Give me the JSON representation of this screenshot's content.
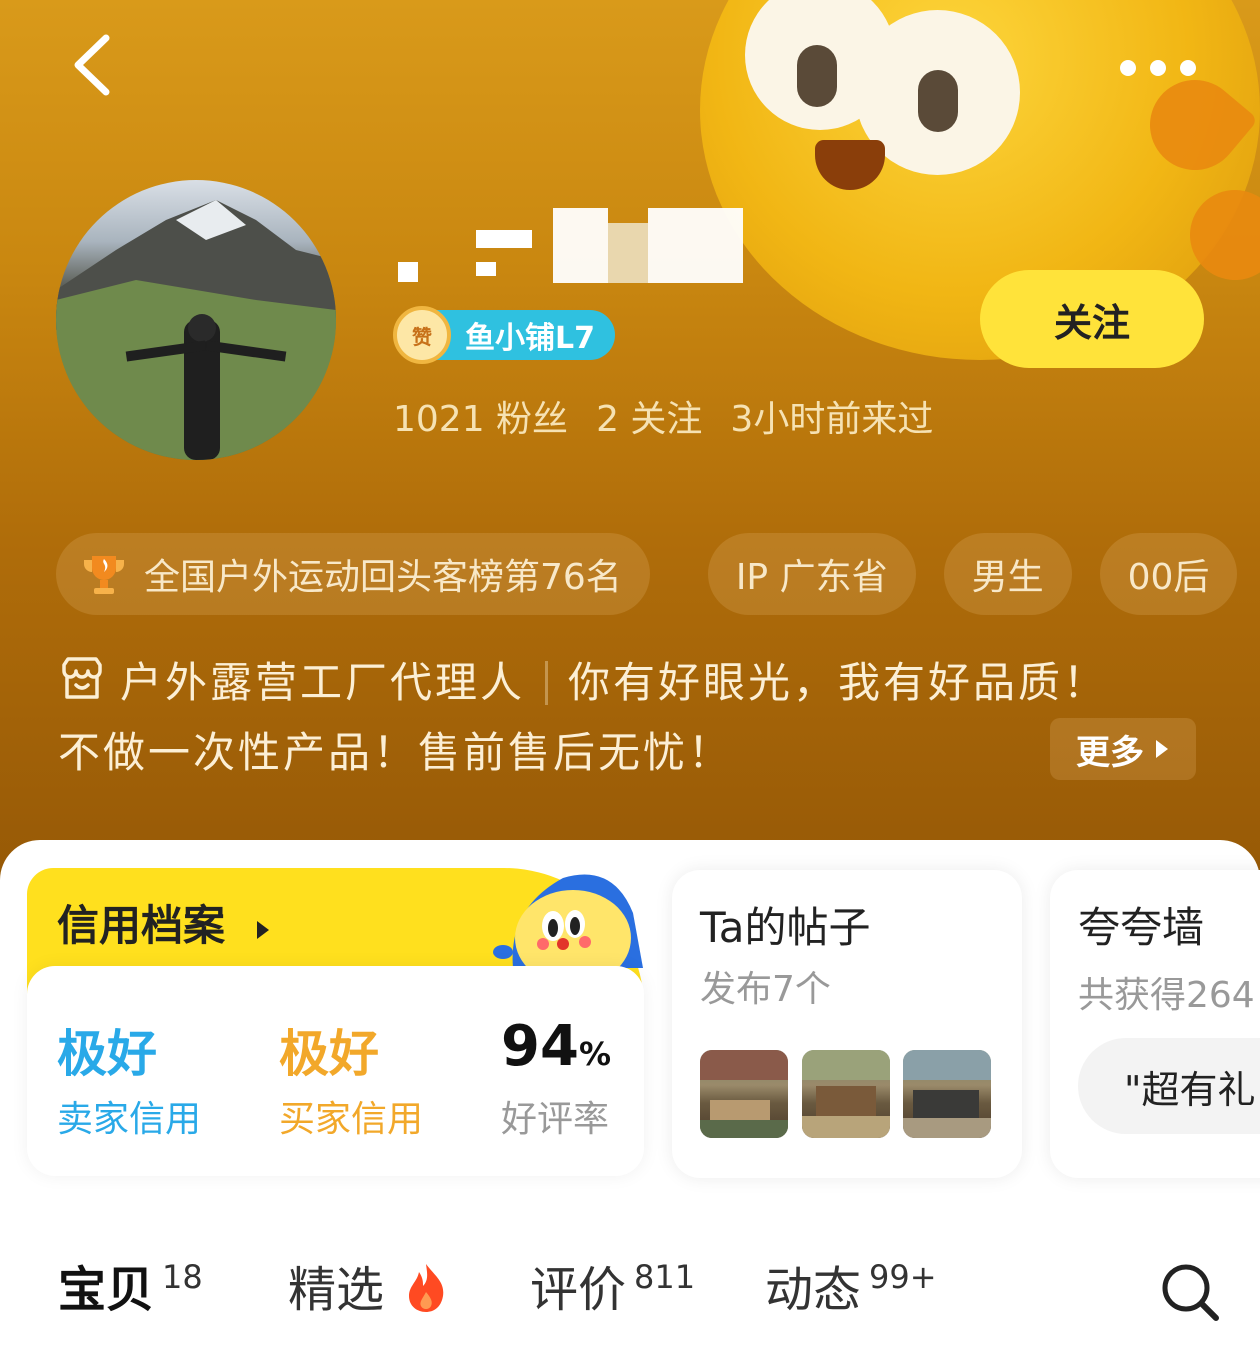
{
  "header": {
    "back_icon": "chevron-left-icon",
    "more_icon": "more-dots-icon"
  },
  "profile": {
    "badge_zan": "赞",
    "badge_level": "鱼小铺L7",
    "stats": {
      "fans": "1021 粉丝",
      "following": "2 关注",
      "last_seen": "3小时前来过"
    },
    "follow_label": "关注"
  },
  "tags": [
    {
      "label": "全国户外运动回头客榜第76名",
      "icon": "trophy-icon"
    },
    {
      "label": "IP 广东省"
    },
    {
      "label": "男生"
    },
    {
      "label": "00后"
    }
  ],
  "bio": {
    "line1a": "户外露营工厂代理人",
    "line1b": "你有好眼光，我有好品质！",
    "line2": "不做一次性产品！售前售后无忧！",
    "more_label": "更多"
  },
  "credit": {
    "title": "信用档案",
    "seller_value": "极好",
    "seller_label": "卖家信用",
    "buyer_value": "极好",
    "buyer_label": "买家信用",
    "rate_value": "94",
    "rate_unit": "%",
    "rate_label": "好评率",
    "colors": {
      "seller": "#29a9e8",
      "buyer": "#f2a82a"
    }
  },
  "posts": {
    "title": "Ta的帖子",
    "subtitle": "发布7个"
  },
  "praise": {
    "title": "夸夸墙",
    "subtitle": "共获得264",
    "quote": "\"超有礼"
  },
  "tabs": [
    {
      "label": "宝贝",
      "count": "18"
    },
    {
      "label": "精选",
      "icon": "fire-icon"
    },
    {
      "label": "评价",
      "count": "811"
    },
    {
      "label": "动态",
      "count": "99+"
    }
  ],
  "colors": {
    "accent": "#ffe01e",
    "hero": "#b06d0a"
  }
}
